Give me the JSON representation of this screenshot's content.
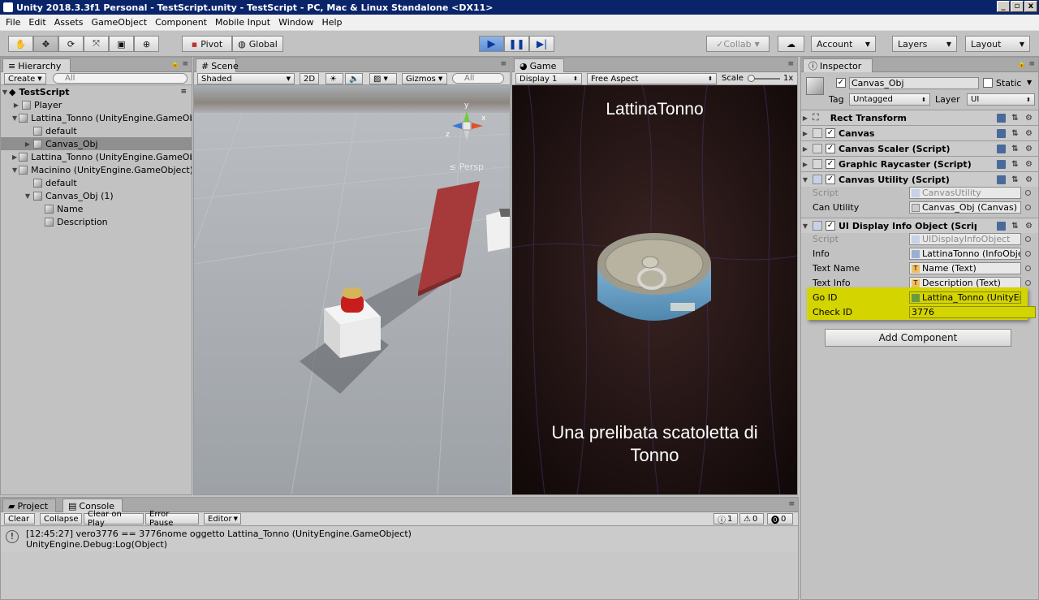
{
  "window": {
    "title": "Unity 2018.3.3f1 Personal - TestScript.unity - TestScript - PC, Mac & Linux Standalone <DX11>",
    "min": "_",
    "restore": "▫",
    "close": "x"
  },
  "menu": [
    "File",
    "Edit",
    "Assets",
    "GameObject",
    "Component",
    "Mobile Input",
    "Window",
    "Help"
  ],
  "toolbar": {
    "pivot": "Pivot",
    "global": "Global",
    "collab": "Collab",
    "account": "Account",
    "layers": "Layers",
    "layout": "Layout"
  },
  "hierarchy": {
    "tab": "Hierarchy",
    "create": "Create",
    "search": "All",
    "scene": "TestScript",
    "items": [
      {
        "label": "Player"
      },
      {
        "label": "Lattina_Tonno (UnityEngine.GameObject)"
      },
      {
        "label": "default"
      },
      {
        "label": "Canvas_Obj"
      },
      {
        "label": "Lattina_Tonno (UnityEngine.GameObject)"
      },
      {
        "label": "Macinino (UnityEngine.GameObject)"
      },
      {
        "label": "default"
      },
      {
        "label": "Canvas_Obj (1)"
      },
      {
        "label": "Name"
      },
      {
        "label": "Description"
      }
    ]
  },
  "scene": {
    "tab": "Scene",
    "shading": "Shaded",
    "mode2d": "2D",
    "gizmos": "Gizmos",
    "search": "All",
    "persp": "Persp",
    "axes": {
      "x": "x",
      "y": "y",
      "z": "z"
    }
  },
  "game": {
    "tab": "Game",
    "display": "Display 1",
    "aspect": "Free Aspect",
    "scale_label": "Scale",
    "scale_value": "1x",
    "title_text": "LattinaTonno",
    "description_text": "Una prelibata scatoletta di Tonno"
  },
  "inspector": {
    "tab": "Inspector",
    "object_name": "Canvas_Obj",
    "static_label": "Static",
    "tag_label": "Tag",
    "tag_value": "Untagged",
    "layer_label": "Layer",
    "layer_value": "UI",
    "components": {
      "rect": "Rect Transform",
      "canvas": "Canvas",
      "scaler": "Canvas Scaler (Script)",
      "raycaster": "Graphic Raycaster (Script)",
      "utility": "Canvas Utility (Script)",
      "display": "UI Display Info Object (Script)"
    },
    "utility_props": {
      "script_label": "Script",
      "script_value": "CanvasUtility",
      "can_label": "Can Utility",
      "can_value": "Canvas_Obj (Canvas)"
    },
    "display_props": {
      "script_label": "Script",
      "script_value": "UIDisplayInfoObject",
      "info_label": "Info",
      "info_value": "LattinaTonno (InfoObject)",
      "textname_label": "Text Name",
      "textname_value": "Name (Text)",
      "textinfo_label": "Text Info",
      "textinfo_value": "Description (Text)",
      "goid_label": "Go ID",
      "goid_value": "Lattina_Tonno (UnityEngine.GameObject)",
      "checkid_label": "Check ID",
      "checkid_value": "3776"
    },
    "add_component": "Add Component"
  },
  "bottom": {
    "project_tab": "Project",
    "console_tab": "Console",
    "buttons": {
      "clear": "Clear",
      "collapse": "Collapse",
      "clear_on_play": "Clear on Play",
      "error_pause": "Error Pause",
      "editor": "Editor"
    },
    "counts": {
      "log": "1",
      "warn": "0",
      "error": "0"
    },
    "log_line1": "[12:45:27] vero3776 == 3776nome oggetto Lattina_Tonno (UnityEngine.GameObject)",
    "log_line2": "UnityEngine.Debug:Log(Object)"
  },
  "colors": {
    "highlight": "#d4d400",
    "selection": "#8f8f8f",
    "play_blue": "#5f8ed3"
  }
}
